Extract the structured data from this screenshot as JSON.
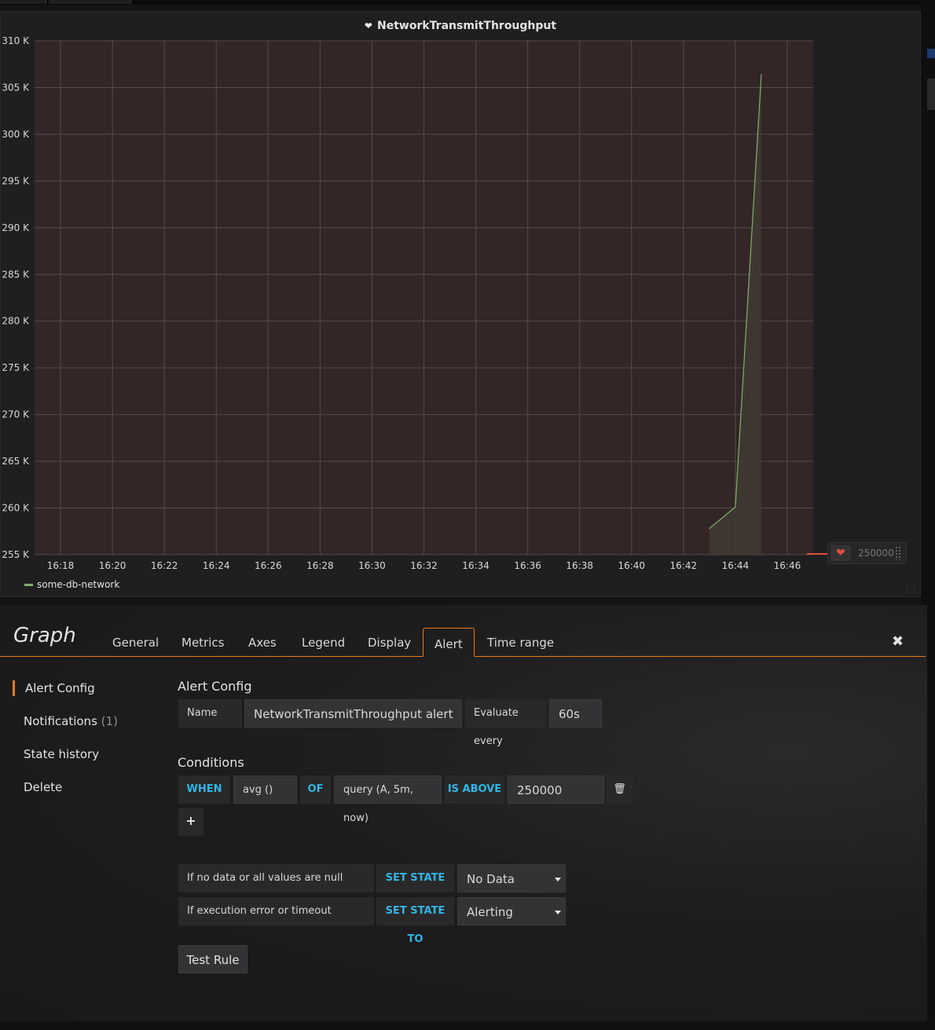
{
  "panel": {
    "title": "NetworkTransmitThroughput",
    "heart_icon": "heart-icon",
    "legend": {
      "series_name": "some-db-network",
      "color": "#7eb26d"
    },
    "threshold": {
      "value": "250000",
      "color": "#e24d42"
    }
  },
  "chart_data": {
    "type": "line",
    "title": "NetworkTransmitThroughput",
    "x_ticks": [
      "16:18",
      "16:20",
      "16:22",
      "16:24",
      "16:26",
      "16:28",
      "16:30",
      "16:32",
      "16:34",
      "16:36",
      "16:38",
      "16:40",
      "16:42",
      "16:44",
      "16:46"
    ],
    "y_ticks": [
      "310 K",
      "305 K",
      "300 K",
      "295 K",
      "290 K",
      "285 K",
      "280 K",
      "275 K",
      "270 K",
      "265 K",
      "260 K",
      "255 K"
    ],
    "ylim": [
      255000,
      310000
    ],
    "xlim": [
      "16:17",
      "16:47"
    ],
    "series": [
      {
        "name": "some-db-network",
        "color": "#7eb26d",
        "points": [
          {
            "t": "16:43",
            "v": 257800
          },
          {
            "t": "16:44",
            "v": 260100
          },
          {
            "t": "16:45",
            "v": 306400
          }
        ]
      }
    ],
    "threshold": 250000,
    "grid": true,
    "legend": "bottom-left"
  },
  "editor": {
    "title": "Graph",
    "tabs": [
      "General",
      "Metrics",
      "Axes",
      "Legend",
      "Display",
      "Alert",
      "Time range"
    ],
    "active_tab": "Alert",
    "close_icon": "close-icon"
  },
  "sidebar": {
    "items": [
      {
        "label": "Alert Config"
      },
      {
        "label": "Notifications",
        "count": "(1)"
      },
      {
        "label": "State history"
      },
      {
        "label": "Delete"
      }
    ]
  },
  "alert_config": {
    "section_title": "Alert Config",
    "name_label": "Name",
    "name_value": "NetworkTransmitThroughput alert",
    "evaluate_label": "Evaluate every",
    "evaluate_value": "60s"
  },
  "conditions": {
    "section_title": "Conditions",
    "when": "WHEN",
    "reducer": "avg ()",
    "of": "OF",
    "query": "query (A, 5m, now)",
    "evaluator": "IS ABOVE",
    "threshold": "250000",
    "delete_icon": "trash-icon",
    "add_icon": "plus-icon",
    "add_label": "+"
  },
  "state_rules": [
    {
      "label": "If no data or all values are null",
      "action": "SET STATE TO",
      "value": "No Data"
    },
    {
      "label": "If execution error or timeout",
      "action": "SET STATE TO",
      "value": "Alerting"
    }
  ],
  "test_button": "Test Rule"
}
